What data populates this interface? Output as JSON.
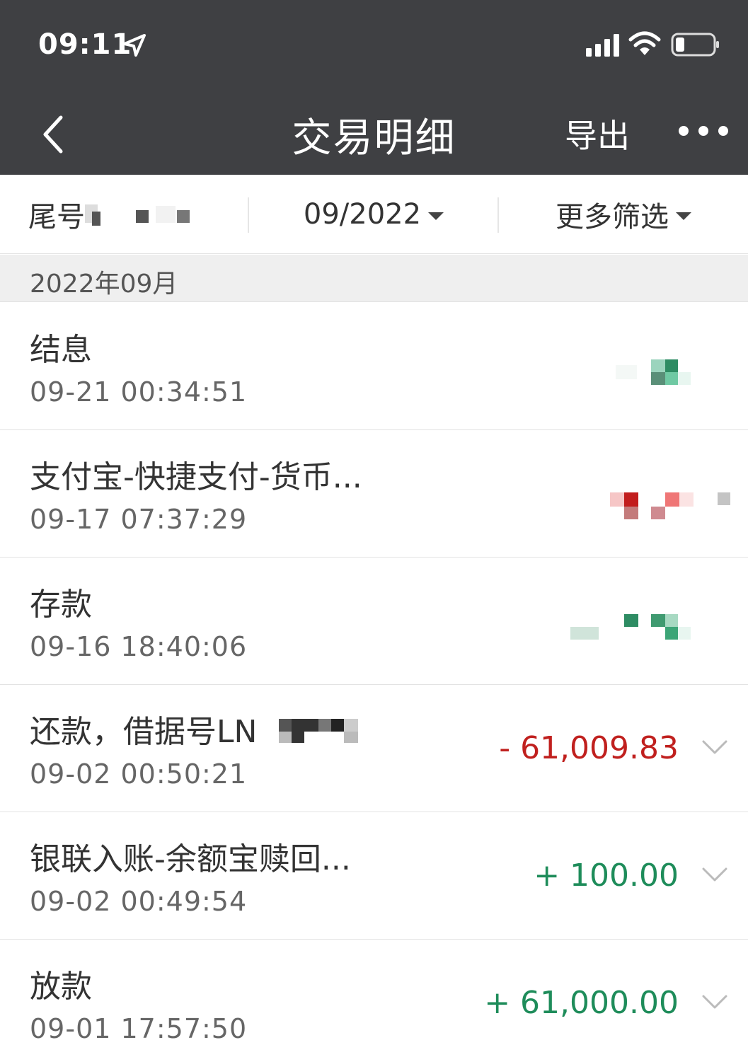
{
  "status_bar": {
    "time": "09:11"
  },
  "nav": {
    "title": "交易明细",
    "export_label": "导出"
  },
  "filters": {
    "account_label": "尾号",
    "month": "09/2022",
    "more": "更多筛选"
  },
  "section": {
    "label": "2022年09月"
  },
  "colors": {
    "header_bg": "#3f4043",
    "expense": "#c0201e",
    "income": "#1e8c5a"
  },
  "transactions": [
    {
      "title": "结息",
      "time": "09-21 00:34:51",
      "amount": ""
    },
    {
      "title": "支付宝-快捷支付-货币...",
      "time": "09-17 07:37:29",
      "amount": ""
    },
    {
      "title": "存款",
      "time": "09-16 18:40:06",
      "amount": ""
    },
    {
      "title": "还款，借据号LN",
      "time": "09-02 00:50:21",
      "amount": "- 61,009.83"
    },
    {
      "title": "银联入账-余额宝赎回...",
      "time": "09-02 00:49:54",
      "amount": "+ 100.00"
    },
    {
      "title": "放款",
      "time": "09-01 17:57:50",
      "amount": "+ 61,000.00"
    }
  ]
}
